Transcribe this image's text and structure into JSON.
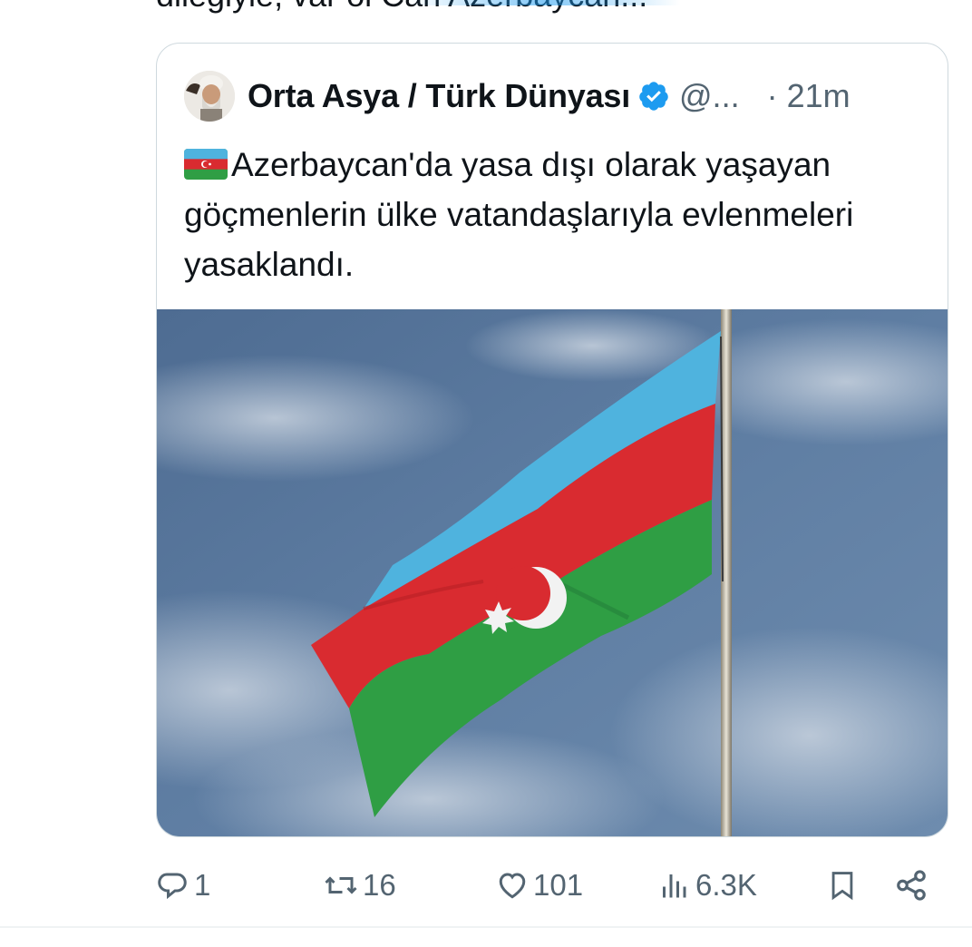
{
  "previous_tweet": {
    "text_tail": "dileğiyle, var ol Can Azerbaycan..."
  },
  "quoted_tweet": {
    "author_name": "Orta Asya / Türk Dünyası",
    "verified": true,
    "handle": "@...",
    "time": "· 21m",
    "text": "Azerbaycan'da yasa dışı olarak yaşayan göçmenlerin ülke vatandaşlarıyla evlenmeleri yasaklandı.",
    "flag_emoji": "azerbaijan-flag-emoji",
    "image": "azerbaijan-flag-on-pole-photo"
  },
  "actions": {
    "replies": "1",
    "reposts": "16",
    "likes": "101",
    "views": "6.3K"
  },
  "colors": {
    "text": "#0f1419",
    "secondary": "#536471",
    "verified": "#1d9bf0",
    "border": "#cfd9de",
    "flag_blue": "#4fb3de",
    "flag_red": "#d92b30",
    "flag_green": "#2f9e44"
  }
}
